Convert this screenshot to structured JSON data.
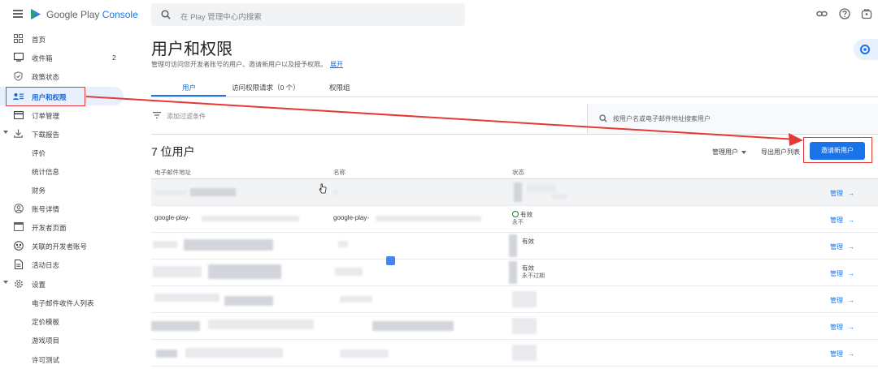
{
  "brand": {
    "part1": "Google Play",
    "part2": "Console"
  },
  "search": {
    "placeholder": "在 Play 管理中心内搜索"
  },
  "sidebar": {
    "items": [
      {
        "label": "首页",
        "icon": "grid-icon"
      },
      {
        "label": "收件箱",
        "icon": "inbox-icon",
        "count": "2"
      },
      {
        "label": "政策状态",
        "icon": "shield-icon"
      },
      {
        "label": "用户和权限",
        "icon": "users-icon"
      },
      {
        "label": "订单管理",
        "icon": "card-icon"
      },
      {
        "label": "下载报告",
        "icon": "download-icon"
      },
      {
        "label": "评价"
      },
      {
        "label": "统计信息"
      },
      {
        "label": "财务"
      },
      {
        "label": "账号详情",
        "icon": "account-icon"
      },
      {
        "label": "开发者页面",
        "icon": "page-icon"
      },
      {
        "label": "关联的开发者账号",
        "icon": "link-account-icon"
      },
      {
        "label": "活动日志",
        "icon": "log-icon"
      },
      {
        "label": "设置",
        "icon": "gear-icon"
      },
      {
        "label": "电子邮件收件人列表"
      },
      {
        "label": "定价模板"
      },
      {
        "label": "游戏项目"
      },
      {
        "label": "许可测试"
      }
    ]
  },
  "page": {
    "title": "用户和权限",
    "subtitle": "管理可访问您开发者账号的用户、邀请新用户以及授予权限。",
    "expand": "展开"
  },
  "tabs": [
    {
      "label": "用户"
    },
    {
      "label": "访问权限请求（0 个）"
    },
    {
      "label": "权限组"
    }
  ],
  "filter": {
    "placeholder": "添加过滤条件"
  },
  "user_search": {
    "placeholder": "按用户名或电子邮件地址搜索用户"
  },
  "users": {
    "count_title": "7 位用户",
    "manage_users": "管理用户",
    "export": "导出用户列表",
    "invite": "邀请新用户",
    "columns": {
      "email": "电子邮件地址",
      "name": "名称",
      "status": "状态"
    },
    "rows": [
      {
        "email": "",
        "name": "",
        "status": "",
        "status_sub": "",
        "action": "管理"
      },
      {
        "email": "google-play-",
        "name": "google-play-",
        "status": "有效",
        "status_sub": "永不",
        "action": "管理"
      },
      {
        "email": "",
        "name": "",
        "status": "有效",
        "status_sub": "",
        "action": "管理"
      },
      {
        "email": "",
        "name": "",
        "status": "有效",
        "status_sub": "永不过期",
        "action": "管理"
      },
      {
        "email": "",
        "name": "",
        "status": "",
        "status_sub": "",
        "action": "管理"
      },
      {
        "email": "",
        "name": "",
        "status": "",
        "status_sub": "",
        "action": "管理"
      },
      {
        "email": "",
        "name": "",
        "status": "",
        "status_sub": "",
        "action": "管理"
      }
    ]
  },
  "colors": {
    "accent": "#1a73e8",
    "annotation": "#e53935",
    "success": "#188038"
  }
}
